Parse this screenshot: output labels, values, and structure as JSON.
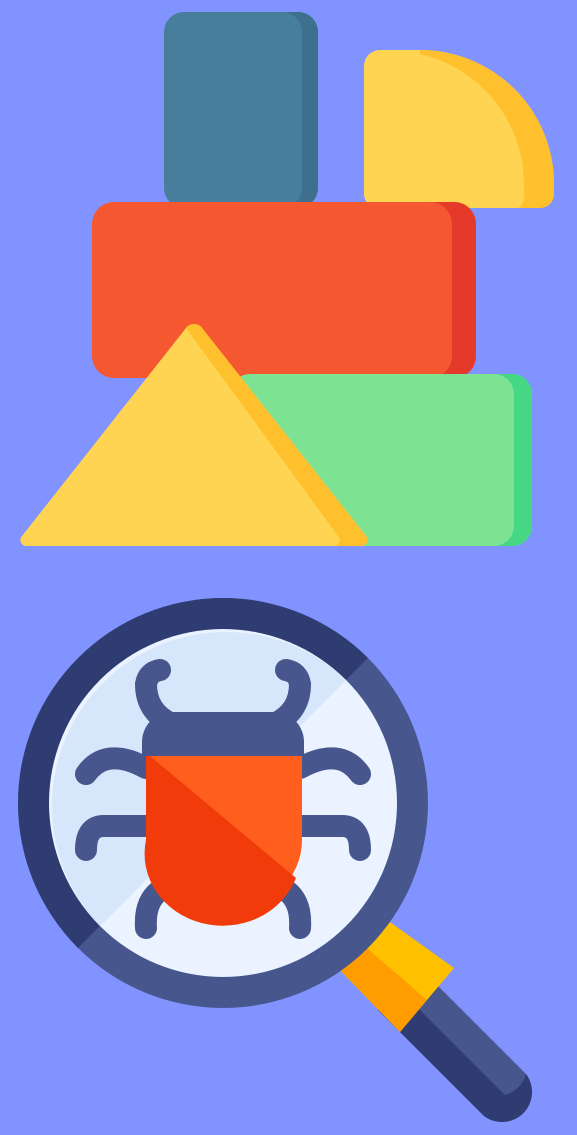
{
  "background": "#8093FF",
  "illustrations": [
    {
      "name": "toy-building-blocks",
      "icons": [
        "square-block-icon",
        "quarter-circle-block-icon",
        "rectangle-block-icon",
        "green-block-icon",
        "triangle-block-icon"
      ],
      "colors": {
        "teal": "#467E9B",
        "teal_shade": "#3E6F8D",
        "yellow": "#FFD452",
        "yellow_shade": "#FFC02E",
        "red": "#F55731",
        "red_shade": "#E53A2A",
        "green": "#7DE393",
        "green_shade": "#46D784"
      }
    },
    {
      "name": "bug-under-magnifying-glass",
      "icons": [
        "magnifier-icon",
        "bug-icon"
      ],
      "colors": {
        "ring_light": "#47568C",
        "ring_dark": "#2F3C72",
        "lens_light": "#EAF3FF",
        "lens_dark": "#D6E6FB",
        "bug_head": "#47568C",
        "bug_shell_light": "#FF5E1C",
        "bug_shell_dark": "#F23B0A",
        "collar_light": "#FFC000",
        "collar_dark": "#FF9D00"
      }
    }
  ]
}
